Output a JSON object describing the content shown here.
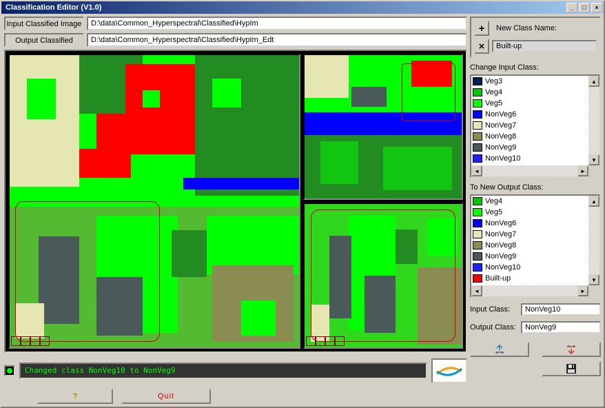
{
  "window": {
    "title": "Classification Editor (V1.0)"
  },
  "paths": {
    "input_label": "Input Classified Image",
    "input_value": "D:\\data\\Common_Hyperspectral\\Classified\\HypIm",
    "output_label": "Output Classified Image",
    "output_value": "D:\\data\\Common_Hyperspectral\\Classified\\HypIm_Edt"
  },
  "new_class": {
    "label": "New Class Name:",
    "value": "Built-up"
  },
  "change_input_label": "Change Input Class:",
  "to_output_label": "To New Output Class:",
  "input_classes": [
    {
      "name": "Veg3",
      "color": "#001f55"
    },
    {
      "name": "Veg4",
      "color": "#00c800"
    },
    {
      "name": "Veg5",
      "color": "#00ff00"
    },
    {
      "name": "NonVeg6",
      "color": "#0000ff"
    },
    {
      "name": "NonVeg7",
      "color": "#e6e6b3"
    },
    {
      "name": "NonVeg8",
      "color": "#8a8c52"
    },
    {
      "name": "NonVeg9",
      "color": "#4a5a5a"
    },
    {
      "name": "NonVeg10",
      "color": "#2020ff"
    }
  ],
  "output_classes": [
    {
      "name": "Veg4",
      "color": "#00c800"
    },
    {
      "name": "Veg5",
      "color": "#00ff00"
    },
    {
      "name": "NonVeg6",
      "color": "#0000ff"
    },
    {
      "name": "NonVeg7",
      "color": "#e6e6b3"
    },
    {
      "name": "NonVeg8",
      "color": "#8a8c52"
    },
    {
      "name": "NonVeg9",
      "color": "#4a5a5a"
    },
    {
      "name": "NonVeg10",
      "color": "#2020ff"
    },
    {
      "name": "Built-up",
      "color": "#ff0000"
    }
  ],
  "io": {
    "input_label": "Input Class:",
    "input_value": "NonVeg10",
    "output_label": "Output Class:",
    "output_value": "NonVeg9"
  },
  "status": "Changed class  NonVeg10  to  NonVeg9",
  "buttons": {
    "help": "?",
    "quit": "Quit"
  }
}
